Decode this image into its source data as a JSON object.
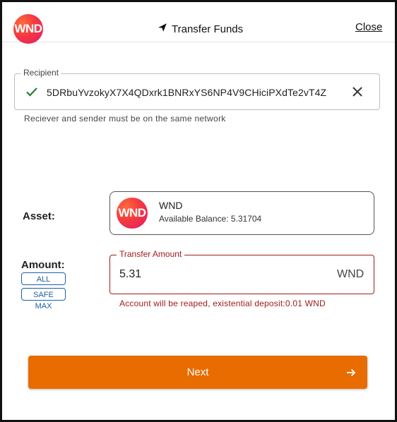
{
  "header": {
    "logo_text": "WND",
    "title": "Transfer Funds",
    "title_icon": "send-icon",
    "close_label": "Close"
  },
  "recipient": {
    "legend": "Recipient",
    "address": "5DRbuYvzokyX7X4QDxrk1BNRxYS6NP4V9CHiciPXdTe2vT4Z",
    "valid_icon": "check-icon",
    "clear_icon": "close-icon",
    "helper_text": "Reciever and sender must be on the same network"
  },
  "asset": {
    "label": "Asset:",
    "logo_text": "WND",
    "name": "WND",
    "balance_text": "Available Balance: 5.31704"
  },
  "amount": {
    "label": "Amount:",
    "all_label": "ALL",
    "safe_max_label": "SAFE MAX",
    "legend": "Transfer Amount",
    "value": "5.31",
    "unit": "WND",
    "error_text": "Account will be reaped, existential deposit:0.01 WND"
  },
  "next": {
    "label": "Next",
    "icon": "arrow-right-icon"
  },
  "colors": {
    "accent": "#e86c00",
    "error": "#a11b1b",
    "link": "#1f5fa8",
    "valid": "#2e7d32"
  }
}
